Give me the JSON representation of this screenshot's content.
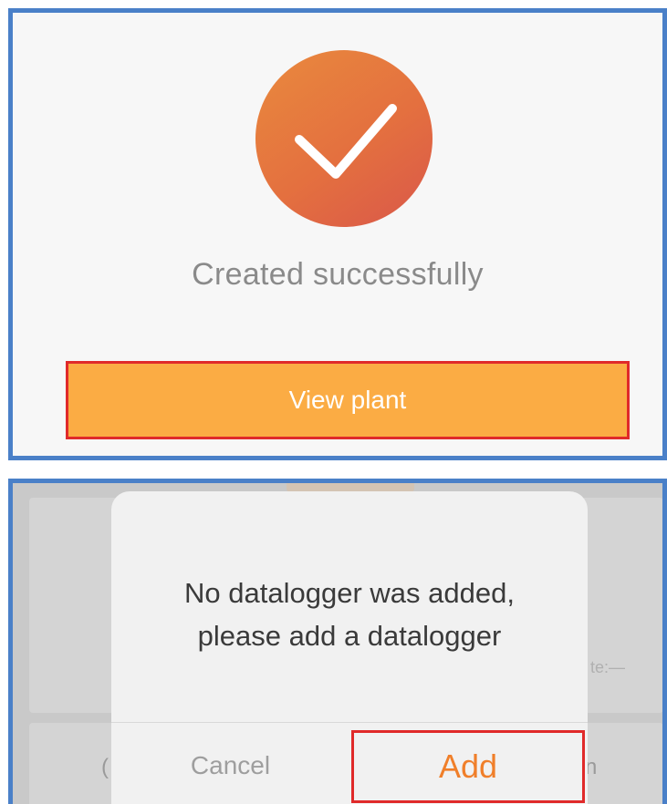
{
  "success_panel": {
    "icon": "checkmark-icon",
    "message": "Created successfully",
    "view_plant_label": "View plant"
  },
  "dialog": {
    "message_line1": "No datalogger was added,",
    "message_line2": "please add a datalogger",
    "cancel_label": "Cancel",
    "add_label": "Add"
  },
  "background_fragments": {
    "date_fragment": "te:—",
    "left_fragment": "(",
    "right_fragment": "n"
  },
  "colors": {
    "panel_border": "#4a80c8",
    "highlight_border": "#e02a2a",
    "primary_button": "#fbac44",
    "accent_text": "#f07f2a",
    "circle_gradient": [
      "#e98a3e",
      "#d9574a"
    ]
  }
}
